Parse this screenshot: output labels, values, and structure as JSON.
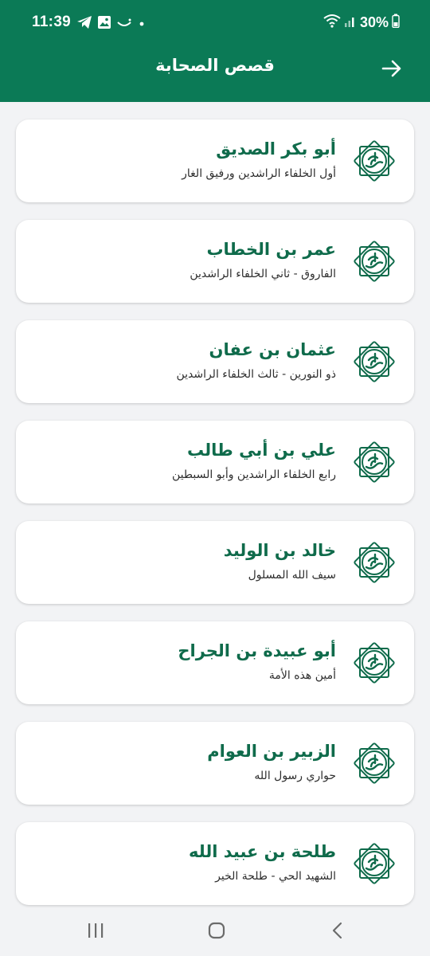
{
  "status_bar": {
    "time": "11:39",
    "battery": "30%",
    "left_icons": [
      "telegram-icon",
      "gallery-icon",
      "app-icon",
      "dot-icon"
    ],
    "right_icons": [
      "wifi-icon",
      "signal-icon",
      "battery-icon"
    ]
  },
  "header": {
    "title": "قصص الصحابة",
    "back_icon": "arrow-right-icon",
    "background": "#0b7a56"
  },
  "colors": {
    "accent": "#0b7a56",
    "name_text": "#0f6b4b",
    "background": "#f2f3f5",
    "card": "#ffffff"
  },
  "companions": [
    {
      "name": "أبو بكر الصديق",
      "subtitle": "أول الخلفاء الراشدين ورفيق الغار"
    },
    {
      "name": "عمر بن الخطاب",
      "subtitle": "الفاروق - ثاني الخلفاء الراشدين"
    },
    {
      "name": "عثمان بن عفان",
      "subtitle": "ذو النورين - ثالث الخلفاء الراشدين"
    },
    {
      "name": "علي بن أبي طالب",
      "subtitle": "رابع الخلفاء الراشدين وأبو السبطين"
    },
    {
      "name": "خالد بن الوليد",
      "subtitle": "سيف الله المسلول"
    },
    {
      "name": "أبو عبيدة بن الجراح",
      "subtitle": "أمين هذه الأمة"
    },
    {
      "name": "الزبير بن العوام",
      "subtitle": "حواري رسول الله"
    },
    {
      "name": "طلحة بن عبيد الله",
      "subtitle": "الشهيد الحي - طلحة الخير"
    }
  ],
  "emblem_icon": "muhammad-calligraphy-emblem-icon",
  "nav_bar": {
    "icons": [
      "recent-apps-icon",
      "home-icon",
      "back-icon"
    ]
  }
}
